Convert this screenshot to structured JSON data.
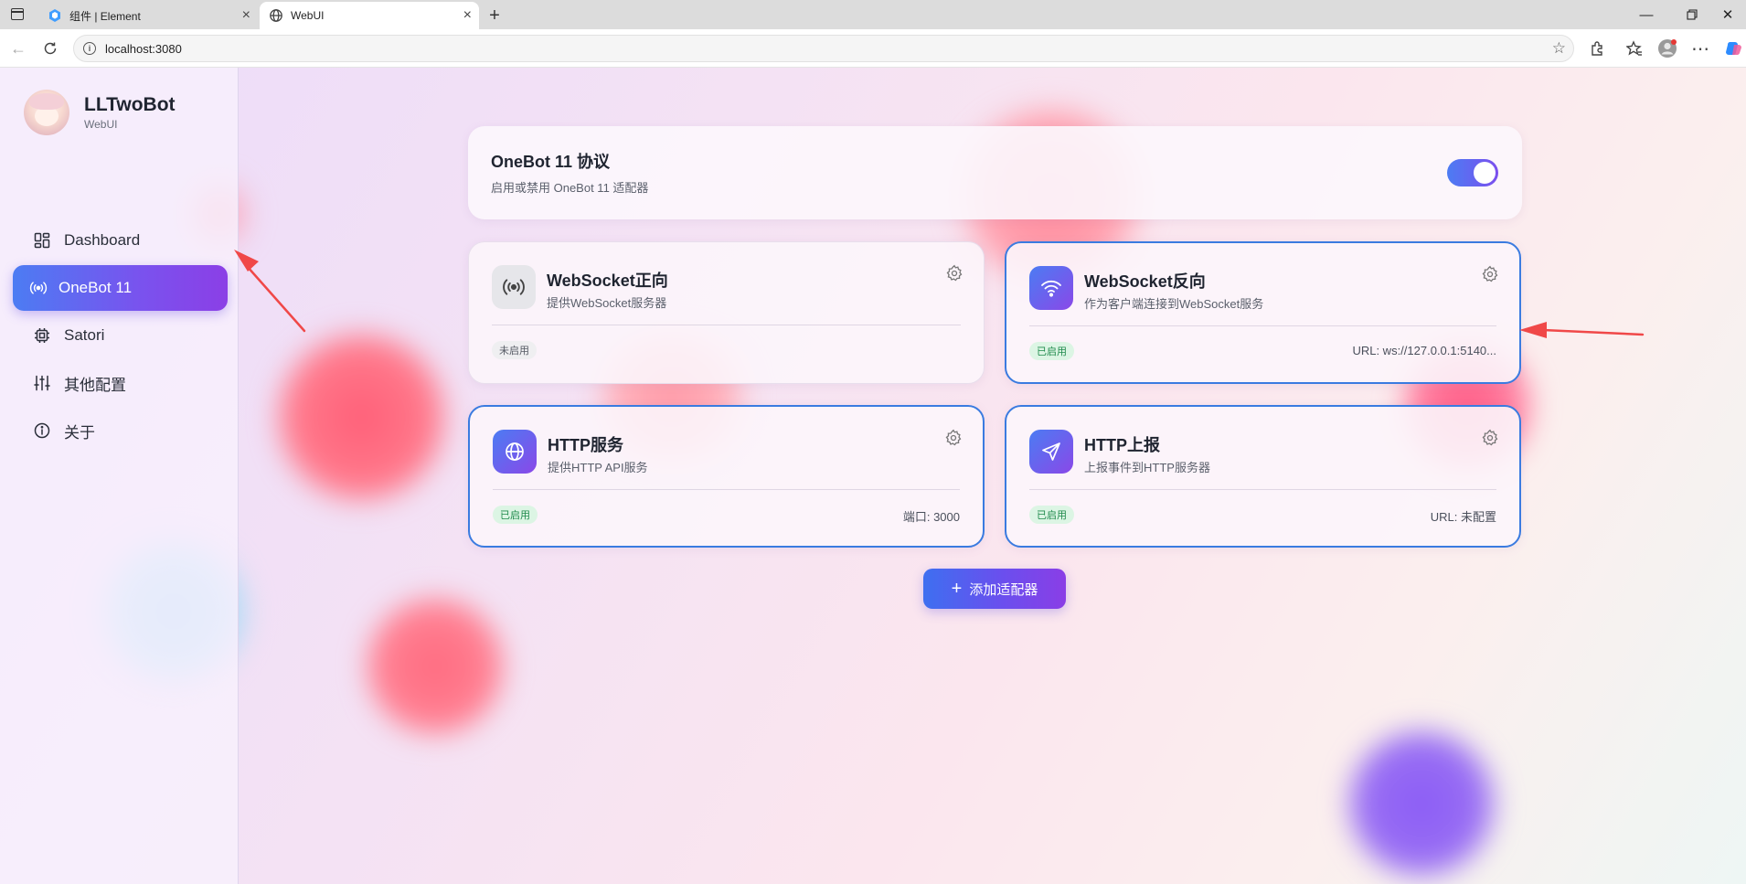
{
  "browser": {
    "tabs": [
      {
        "title": "组件 | Element"
      },
      {
        "title": "WebUI"
      }
    ],
    "address": "localhost:3080"
  },
  "sidebar": {
    "brand_name": "LLTwoBot",
    "brand_sub": "WebUI",
    "items": [
      {
        "label": "Dashboard",
        "icon": "dashboard-icon"
      },
      {
        "label": "OneBot 11",
        "icon": "broadcast-icon",
        "active": true
      },
      {
        "label": "Satori",
        "icon": "chip-icon"
      },
      {
        "label": "其他配置",
        "icon": "sliders-icon"
      },
      {
        "label": "关于",
        "icon": "info-icon"
      }
    ]
  },
  "protocol": {
    "title": "OneBot 11 协议",
    "subtitle": "启用或禁用 OneBot 11 适配器",
    "enabled": true
  },
  "adapters": [
    {
      "title": "WebSocket正向",
      "subtitle": "提供WebSocket服务器",
      "status": "未启用",
      "meta": "",
      "icon": "broadcast-icon"
    },
    {
      "title": "WebSocket反向",
      "subtitle": "作为客户端连接到WebSocket服务",
      "status": "已启用",
      "meta": "URL: ws://127.0.0.1:5140...",
      "icon": "wifi-icon"
    },
    {
      "title": "HTTP服务",
      "subtitle": "提供HTTP API服务",
      "status": "已启用",
      "meta": "端口: 3000",
      "icon": "globe-icon"
    },
    {
      "title": "HTTP上报",
      "subtitle": "上报事件到HTTP服务器",
      "status": "已启用",
      "meta": "URL: 未配置",
      "icon": "send-icon"
    }
  ],
  "add_button": {
    "label": "添加适配器"
  },
  "colors": {
    "accent_start": "#4c7cf3",
    "accent_end": "#8b3fe6",
    "enabled_border": "#3a7be0",
    "status_on_bg": "#dcf5e4",
    "status_on_text": "#1f8a4c",
    "annotation_arrow": "#f04848"
  }
}
